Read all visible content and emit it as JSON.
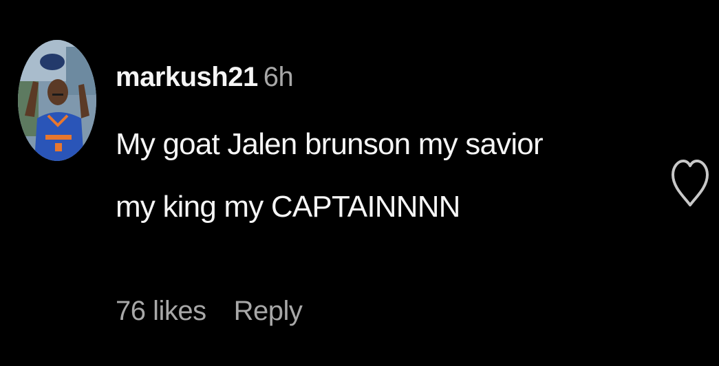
{
  "comment": {
    "username": "markush21",
    "timestamp": "6h",
    "text_line_1": "My goat Jalen brunson my savior",
    "text_line_2": "my king my CAPTAINNNN",
    "likes_label": "76 likes",
    "reply_label": "Reply",
    "like_icon": "heart-outline-icon",
    "avatar_icon": "profile-photo"
  },
  "colors": {
    "background": "#000000",
    "primary_text": "#f5f5f5",
    "secondary_text": "#a8a8a8",
    "icon": "#c8c8c8"
  }
}
